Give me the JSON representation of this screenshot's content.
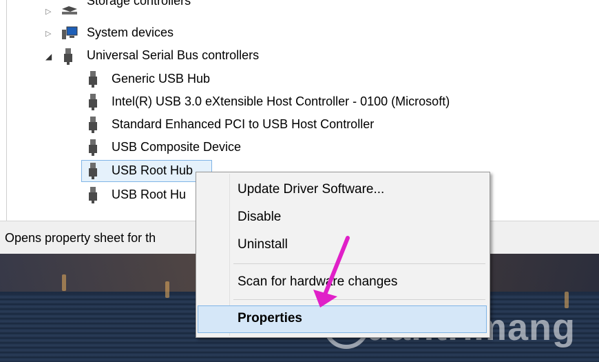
{
  "tree": {
    "items": [
      {
        "label": "Storage controllers",
        "expander": "collapsed",
        "icon": "storage-controller-icon"
      },
      {
        "label": "System devices",
        "expander": "collapsed",
        "icon": "system-devices-icon"
      },
      {
        "label": "Universal Serial Bus controllers",
        "expander": "expanded",
        "icon": "usb-plug-icon"
      },
      {
        "label": "Generic USB Hub",
        "icon": "usb-plug-icon"
      },
      {
        "label": "Intel(R) USB 3.0 eXtensible Host Controller - 0100 (Microsoft)",
        "icon": "usb-plug-icon"
      },
      {
        "label": "Standard Enhanced PCI to USB Host Controller",
        "icon": "usb-plug-icon"
      },
      {
        "label": "USB Composite Device",
        "icon": "usb-plug-icon"
      },
      {
        "label": "USB Root Hub",
        "icon": "usb-plug-icon",
        "selected": true
      },
      {
        "label": "USB Root Hu",
        "icon": "usb-plug-icon"
      }
    ]
  },
  "status": {
    "text": "Opens property sheet for th"
  },
  "context_menu": {
    "items": [
      {
        "label": "Update Driver Software..."
      },
      {
        "label": "Disable"
      },
      {
        "label": "Uninstall"
      },
      {
        "label": "Scan for hardware changes"
      },
      {
        "label": "Properties",
        "highlighted": true
      }
    ]
  },
  "watermark": {
    "text": "uantrimang"
  },
  "colors": {
    "selection": "#e5f1fb",
    "selection_border": "#7fb4e6",
    "arrow": "#e020c8"
  }
}
